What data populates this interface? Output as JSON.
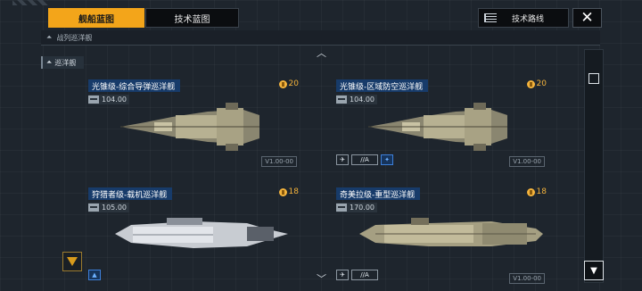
{
  "tabs": [
    {
      "label": "舰船蓝图",
      "active": true
    },
    {
      "label": "技术蓝图",
      "active": false
    }
  ],
  "tech_route_label": "技术路线",
  "close_icon": "close-icon",
  "breadcrumb": {
    "label": "战列巡洋舰"
  },
  "section": {
    "label": "巡洋舰"
  },
  "cards": [
    {
      "title": "光锥级-综合导弹巡洋舰",
      "cost": "20",
      "metric": "104.00",
      "version": "V1.00-00",
      "tags": []
    },
    {
      "title": "光锥级-区域防空巡洋舰",
      "cost": "20",
      "metric": "104.00",
      "version": "V1.00-00",
      "tags": [
        "//A"
      ]
    },
    {
      "title": "狩猎者级-载机巡洋舰",
      "cost": "18",
      "metric": "105.00",
      "version": "",
      "tags": []
    },
    {
      "title": "奇美拉级-重型巡洋舰",
      "cost": "18",
      "metric": "170.00",
      "version": "V1.00-00",
      "tags": [
        "//A"
      ]
    }
  ],
  "colors": {
    "accent": "#f3a51a",
    "title_bg": "#173b6a",
    "cost": "#f4b33c"
  }
}
